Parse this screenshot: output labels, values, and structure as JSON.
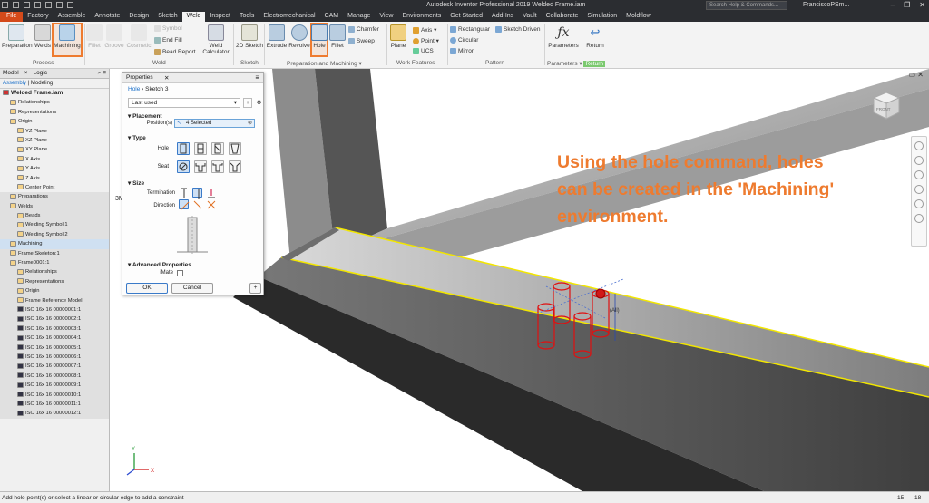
{
  "app": {
    "title": "Autodesk Inventor Professional 2019   Welded Frame.iam",
    "search_placeholder": "Search Help & Commands...",
    "user": "FranciscoPSm...",
    "window_buttons": [
      "–",
      "❐",
      "✕"
    ]
  },
  "tabs": [
    "File",
    "Factory",
    "Assemble",
    "Annotate",
    "Design",
    "Sketch",
    "Weld",
    "Inspect",
    "Tools",
    "Electromechanical",
    "CAM",
    "Manage",
    "View",
    "Environments",
    "Get Started",
    "Add-Ins",
    "Vault",
    "Collaborate",
    "Simulation",
    "Moldflow"
  ],
  "active_tab": "Weld",
  "ribbon": {
    "process": {
      "label": "Process",
      "preparation": "Preparation",
      "welds": "Welds",
      "machining": "Machining"
    },
    "weld": {
      "label": "Weld",
      "fillet": "Fillet",
      "groove": "Groove",
      "cosmetic": "Cosmetic",
      "symbol": "Symbol",
      "end_fill": "End Fill",
      "bead_report": "Bead Report",
      "weld_calculator": "Weld Calculator"
    },
    "sketch": {
      "label": "Sketch",
      "sketch2d": "2D Sketch"
    },
    "prep_machining": {
      "label": "Preparation and Machining",
      "extrude": "Extrude",
      "revolve": "Revolve",
      "hole": "Hole",
      "fillet": "Fillet",
      "chamfer": "Chamfer",
      "sweep": "Sweep"
    },
    "work_features": {
      "label": "Work Features",
      "plane": "Plane",
      "axis": "Axis",
      "point": "Point",
      "ucs": "UCS"
    },
    "pattern": {
      "label": "Pattern",
      "rectangular": "Rectangular",
      "circular": "Circular",
      "mirror": "Mirror",
      "sketch_driven": "Sketch Driven"
    },
    "parameters": {
      "label": "Parameters",
      "parameters_btn": "Parameters",
      "return_btn": "Return",
      "return_label": "Return"
    }
  },
  "browser": {
    "tabs": [
      "Model",
      "Logic"
    ],
    "subtabs": [
      "Assembly",
      "Modeling"
    ],
    "tree": [
      {
        "label": "Welded Frame.iam",
        "level": 0,
        "kind": "root"
      },
      {
        "label": "Relationships",
        "level": 1
      },
      {
        "label": "Representations",
        "level": 1
      },
      {
        "label": "Origin",
        "level": 1
      },
      {
        "label": "YZ Plane",
        "level": 2
      },
      {
        "label": "XZ Plane",
        "level": 2
      },
      {
        "label": "XY Plane",
        "level": 2
      },
      {
        "label": "X Axis",
        "level": 2
      },
      {
        "label": "Y Axis",
        "level": 2
      },
      {
        "label": "Z Axis",
        "level": 2
      },
      {
        "label": "Center Point",
        "level": 2
      },
      {
        "label": "Preparations",
        "level": 1,
        "kind": "grey"
      },
      {
        "label": "Welds",
        "level": 1,
        "kind": "grey"
      },
      {
        "label": "Beads",
        "level": 2,
        "kind": "grey"
      },
      {
        "label": "Welding Symbol 1",
        "level": 2,
        "kind": "grey"
      },
      {
        "label": "Welding Symbol 2",
        "level": 2,
        "kind": "grey"
      },
      {
        "label": "Machining",
        "level": 1,
        "kind": "sel"
      },
      {
        "label": "Frame Skeleton:1",
        "level": 1,
        "kind": "grey"
      },
      {
        "label": "Frame0001:1",
        "level": 1,
        "kind": "grey"
      },
      {
        "label": "Relationships",
        "level": 2,
        "kind": "grey"
      },
      {
        "label": "Representations",
        "level": 2,
        "kind": "grey"
      },
      {
        "label": "Origin",
        "level": 2,
        "kind": "grey"
      },
      {
        "label": "Frame Reference Model",
        "level": 2,
        "kind": "grey"
      },
      {
        "label": "ISO 16x 16 00000001:1",
        "level": 2,
        "kind": "grey"
      },
      {
        "label": "ISO 16x 16 00000002:1",
        "level": 2,
        "kind": "grey"
      },
      {
        "label": "ISO 16x 16 00000003:1",
        "level": 2,
        "kind": "grey"
      },
      {
        "label": "ISO 16x 16 00000004:1",
        "level": 2,
        "kind": "grey"
      },
      {
        "label": "ISO 16x 16 00000005:1",
        "level": 2,
        "kind": "grey"
      },
      {
        "label": "ISO 16x 16 00000006:1",
        "level": 2,
        "kind": "grey"
      },
      {
        "label": "ISO 16x 16 00000007:1",
        "level": 2,
        "kind": "grey"
      },
      {
        "label": "ISO 16x 16 00000008:1",
        "level": 2,
        "kind": "grey"
      },
      {
        "label": "ISO 16x 16 00000009:1",
        "level": 2,
        "kind": "grey"
      },
      {
        "label": "ISO 16x 16 00000010:1",
        "level": 2,
        "kind": "grey"
      },
      {
        "label": "ISO 16x 16 00000011:1",
        "level": 2,
        "kind": "grey"
      },
      {
        "label": "ISO 16x 16 00000012:1",
        "level": 2,
        "kind": "grey"
      }
    ]
  },
  "properties": {
    "title": "Properties",
    "breadcrumb_link": "Hole",
    "breadcrumb_current": "Sketch 3",
    "preset": "Last used",
    "placement": "Placement",
    "positions_label": "Position(s)",
    "positions_value": "4 Selected",
    "type": "Type",
    "hole_label": "Hole",
    "seat_label": "Seat",
    "size": "Size",
    "termination_label": "Termination",
    "direction_label": "Direction",
    "advanced": "Advanced Properties",
    "imate_label": "iMate",
    "ok": "OK",
    "cancel": "Cancel"
  },
  "viewport": {
    "annotation": "Using the hole command, holes can be created in the 'Machining' environment.",
    "viewcube_label": "FRONT",
    "dimension_label": "(All)",
    "label_3m": "3M",
    "axis_x": "X",
    "axis_y": "Y"
  },
  "status": {
    "message": "Add hole point(s) or select a linear or circular edge to add a constraint",
    "n1": "15",
    "n2": "18"
  },
  "colors": {
    "accent": "#ee7b2f",
    "file_tab": "#d44a1a",
    "hole_red": "#e01010",
    "edge_yellow": "#f2e600"
  }
}
